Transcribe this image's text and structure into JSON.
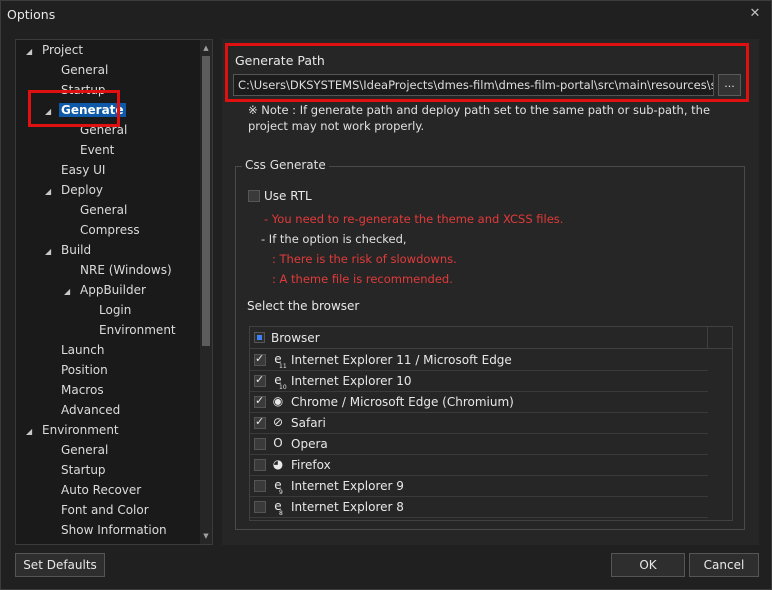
{
  "window": {
    "title": "Options",
    "close_glyph": "✕"
  },
  "tree": {
    "items": [
      {
        "label": "Project",
        "arrow": "◢"
      },
      {
        "label": "General"
      },
      {
        "label": "Startup"
      },
      {
        "label": "Generate",
        "arrow": "◢"
      },
      {
        "label": "General"
      },
      {
        "label": "Event"
      },
      {
        "label": "Easy UI"
      },
      {
        "label": "Deploy",
        "arrow": "◢"
      },
      {
        "label": "General"
      },
      {
        "label": "Compress"
      },
      {
        "label": "Build",
        "arrow": "◢"
      },
      {
        "label": "NRE (Windows)"
      },
      {
        "label": "AppBuilder",
        "arrow": "◢"
      },
      {
        "label": "Login"
      },
      {
        "label": "Environment"
      },
      {
        "label": "Launch"
      },
      {
        "label": "Position"
      },
      {
        "label": "Macros"
      },
      {
        "label": "Advanced"
      },
      {
        "label": "Environment",
        "arrow": "◢"
      },
      {
        "label": "General"
      },
      {
        "label": "Startup"
      },
      {
        "label": "Auto Recover"
      },
      {
        "label": "Font and Color"
      },
      {
        "label": "Show Information"
      }
    ]
  },
  "generate_path": {
    "label": "Generate Path",
    "value": "C:\\Users\\DKSYSTEMS\\IdeaProjects\\dmes-film\\dmes-film-portal\\src\\main\\resources\\stati",
    "browse_label": "...",
    "note": "※ Note : If generate path and deploy path set to the same path or sub-path, the project may not work properly."
  },
  "css_generate": {
    "title": "Css Generate",
    "use_rtl_label": "Use RTL",
    "use_rtl_checked": false,
    "msg1": "- You need to re-generate the theme and XCSS files.",
    "msg2": "- If the option is checked,",
    "msg3": ": There is the risk of slowdowns.",
    "msg4": ": A theme file is recommended.",
    "select_browser_label": "Select the browser",
    "browser_header": "Browser",
    "browsers": [
      {
        "name": "Internet Explorer 11 / Microsoft Edge",
        "checked": true,
        "icon": "ie-icon",
        "glyph": "e",
        "sub": "11"
      },
      {
        "name": "Internet Explorer 10",
        "checked": true,
        "icon": "ie-icon",
        "glyph": "e",
        "sub": "10"
      },
      {
        "name": "Chrome / Microsoft Edge (Chromium)",
        "checked": true,
        "icon": "chrome-icon",
        "glyph": "◉",
        "sub": ""
      },
      {
        "name": "Safari",
        "checked": true,
        "icon": "safari-icon",
        "glyph": "⊘",
        "sub": ""
      },
      {
        "name": "Opera",
        "checked": false,
        "icon": "opera-icon",
        "glyph": "O",
        "sub": ""
      },
      {
        "name": "Firefox",
        "checked": false,
        "icon": "firefox-icon",
        "glyph": "◕",
        "sub": ""
      },
      {
        "name": "Internet Explorer 9",
        "checked": false,
        "icon": "ie-icon",
        "glyph": "e",
        "sub": "9"
      },
      {
        "name": "Internet Explorer 8",
        "checked": false,
        "icon": "ie-icon",
        "glyph": "e",
        "sub": "8"
      }
    ]
  },
  "footer": {
    "set_defaults": "Set Defaults",
    "ok": "OK",
    "cancel": "Cancel"
  },
  "colors": {
    "highlight": "#e01010",
    "warning_text": "#e23a3a",
    "selection": "#0e5aa8"
  }
}
